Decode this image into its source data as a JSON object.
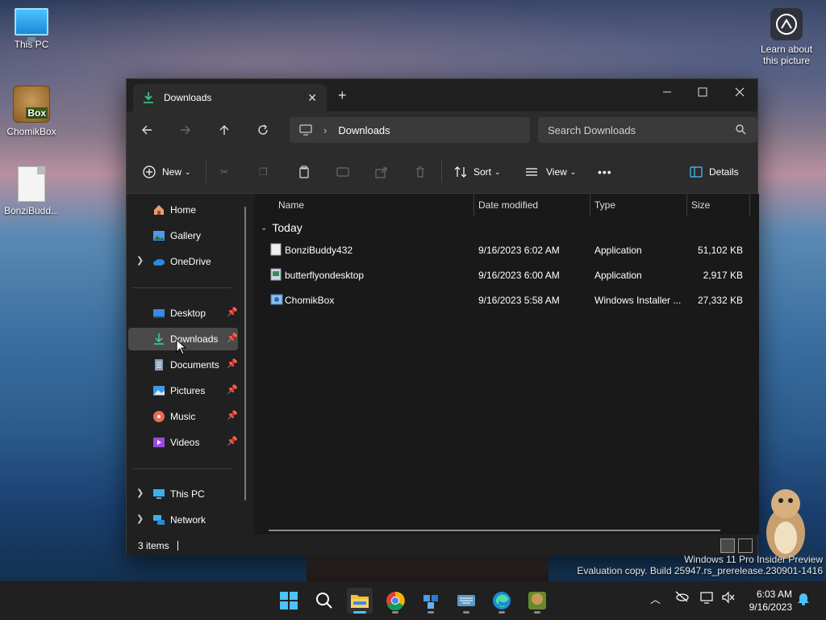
{
  "desktop": {
    "icons": [
      {
        "label": "This PC"
      },
      {
        "label": "ChomikBox"
      },
      {
        "label": "BonziBudd..."
      }
    ],
    "learn_about": "Learn about this picture",
    "chomik_badge": "Box"
  },
  "window": {
    "tab_title": "Downloads",
    "address": {
      "path": "Downloads"
    },
    "search": {
      "placeholder": "Search Downloads"
    },
    "commands": {
      "new": "New",
      "sort": "Sort",
      "view": "View",
      "more": "•••",
      "details": "Details"
    },
    "sidebar": {
      "items": [
        {
          "label": "Home"
        },
        {
          "label": "Gallery"
        },
        {
          "label": "OneDrive"
        },
        {
          "label": "Desktop"
        },
        {
          "label": "Downloads"
        },
        {
          "label": "Documents"
        },
        {
          "label": "Pictures"
        },
        {
          "label": "Music"
        },
        {
          "label": "Videos"
        },
        {
          "label": "This PC"
        },
        {
          "label": "Network"
        }
      ]
    },
    "columns": [
      "Name",
      "Date modified",
      "Type",
      "Size"
    ],
    "group": "Today",
    "files": [
      {
        "name": "BonziBuddy432",
        "date": "9/16/2023 6:02 AM",
        "type": "Application",
        "size": "51,102 KB"
      },
      {
        "name": "butterflyondesktop",
        "date": "9/16/2023 6:00 AM",
        "type": "Application",
        "size": "2,917 KB"
      },
      {
        "name": "ChomikBox",
        "date": "9/16/2023 5:58 AM",
        "type": "Windows Installer ...",
        "size": "27,332 KB"
      }
    ],
    "status": "3 items"
  },
  "taskbar": {
    "time": "6:03 AM",
    "date": "9/16/2023"
  },
  "watermark": {
    "line1": "Windows 11 Pro Insider Preview",
    "line2": "Evaluation copy. Build 25947.rs_prerelease.230901-1416"
  }
}
